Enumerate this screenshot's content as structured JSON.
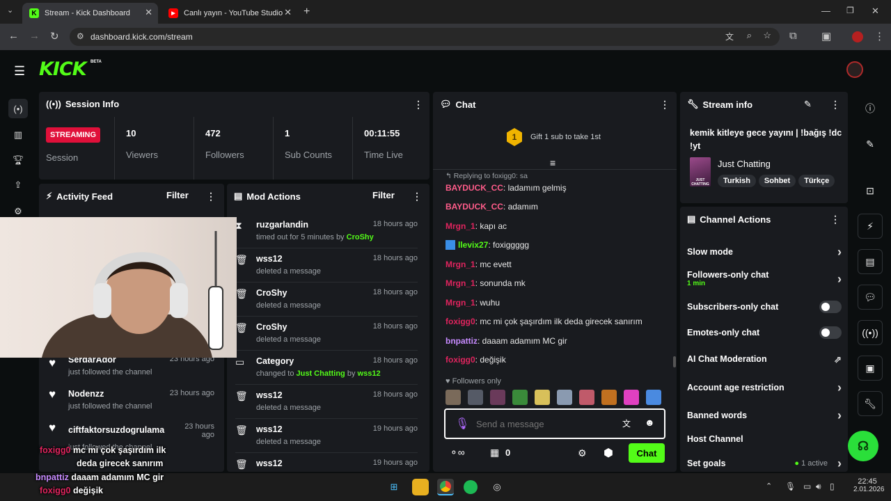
{
  "browser": {
    "tabs": [
      {
        "title": "Stream - Kick Dashboard",
        "active": true
      },
      {
        "title": "Canlı yayın - YouTube Studio",
        "active": false
      }
    ],
    "url": "dashboard.kick.com/stream"
  },
  "app": {
    "logo": "KICK",
    "logo_badge": "BETA",
    "accent": "#53fc18"
  },
  "session": {
    "title": "Session Info",
    "badge": "STREAMING",
    "session_label": "Session",
    "stats": [
      {
        "value": "10",
        "label": "Viewers"
      },
      {
        "value": "472",
        "label": "Followers"
      },
      {
        "value": "1",
        "label": "Sub Counts"
      },
      {
        "value": "00:11:55",
        "label": "Time Live"
      }
    ]
  },
  "activity": {
    "title": "Activity Feed",
    "filter": "Filter",
    "items": [
      {
        "name": "SerdarAdor",
        "time": "23 hours ago",
        "desc": "just followed the channel"
      },
      {
        "name": "Nodenzz",
        "time": "23 hours ago",
        "desc": "just followed the channel"
      },
      {
        "name": "ciftfaktorsuzdogrulama",
        "time": "23 hours ago",
        "desc": "just followed the channel"
      }
    ]
  },
  "mod": {
    "title": "Mod Actions",
    "filter": "Filter",
    "items": [
      {
        "icon": "hourglass-icon",
        "name": "ruzgarlandin",
        "time": "18 hours ago",
        "desc": "timed out for 5 minutes by",
        "target": "CroShy"
      },
      {
        "icon": "trash-icon",
        "name": "wss12",
        "time": "18 hours ago",
        "desc": "deleted a message"
      },
      {
        "icon": "trash-icon",
        "name": "CroShy",
        "time": "18 hours ago",
        "desc": "deleted a message"
      },
      {
        "icon": "trash-icon",
        "name": "CroShy",
        "time": "18 hours ago",
        "desc": "deleted a message"
      },
      {
        "icon": "category-icon",
        "name": "Category",
        "time": "18 hours ago",
        "desc": "changed to",
        "target": "Just Chatting",
        "by": "by",
        "byname": "wss12"
      },
      {
        "icon": "trash-icon",
        "name": "wss12",
        "time": "18 hours ago",
        "desc": "deleted a message"
      },
      {
        "icon": "trash-icon",
        "name": "wss12",
        "time": "19 hours ago",
        "desc": "deleted a message"
      },
      {
        "icon": "trash-icon",
        "name": "wss12",
        "time": "19 hours ago",
        "desc": ""
      }
    ]
  },
  "chat": {
    "title": "Chat",
    "gift_badge": "1",
    "gift_text": "Gift 1 sub to take 1st",
    "reply_text": "Replying to foxigg0: sa",
    "messages": [
      {
        "user": "BAYDUCK_CC",
        "color": "#ff5c8a",
        "text": ": ladamım gelmiş"
      },
      {
        "user": "BAYDUCK_CC",
        "color": "#ff5c8a",
        "text": ": adamım"
      },
      {
        "user": "Mrgn_1",
        "color": "#e0245e",
        "text": ": kapı ac"
      },
      {
        "user": "llevix27",
        "color": "#53fc18",
        "text": ": foxiggggg"
      },
      {
        "user": "Mrgn_1",
        "color": "#e0245e",
        "text": ": mc evett"
      },
      {
        "user": "Mrgn_1",
        "color": "#e0245e",
        "text": ": sonunda mk"
      },
      {
        "user": "Mrgn_1",
        "color": "#e0245e",
        "text": ": wuhu"
      },
      {
        "user": "foxigg0",
        "color": "#e0245e",
        "text": ": mc mi çok şaşırdım ilk deda girecek sanırım"
      },
      {
        "user": "bnpattiz",
        "color": "#c78bff",
        "text": ": daaam adamım MC gir"
      },
      {
        "user": "foxigg0",
        "color": "#e0245e",
        "text": ": değişik"
      }
    ],
    "followers_only": "Followers only",
    "placeholder": "Send a message",
    "count": "0",
    "send": "Chat"
  },
  "stream_info": {
    "title": "Stream info",
    "stream_title": "kemik kitleye gece yayını | !bağış !dc !yt",
    "category": "Just Chatting",
    "thumb_text": "JUST CHATTING",
    "tags": [
      "Turkish",
      "Sohbet",
      "Türkçe"
    ]
  },
  "channel_actions": {
    "title": "Channel Actions",
    "items": [
      {
        "label": "Slow mode",
        "type": "chevron"
      },
      {
        "label": "Followers-only chat",
        "sub": "1 min",
        "type": "chevron"
      },
      {
        "label": "Subscribers-only chat",
        "type": "toggle"
      },
      {
        "label": "Emotes-only chat",
        "type": "toggle"
      },
      {
        "label": "AI Chat Moderation",
        "type": "external"
      },
      {
        "label": "Account age restriction",
        "type": "chevron"
      },
      {
        "label": "Banned words",
        "type": "chevron"
      },
      {
        "label": "Host Channel",
        "type": "none"
      },
      {
        "label": "Set goals",
        "badge": "1 active",
        "type": "chevron"
      }
    ]
  },
  "overlay_chat": [
    {
      "user": "foxigg0",
      "color": "#e0245e",
      "text": "mc mi çok şaşırdım ilk"
    },
    {
      "user": "",
      "color": "#fff",
      "text": "deda girecek sanırım"
    },
    {
      "user": "bnpattiz",
      "color": "#c78bff",
      "text": "daaam adamım MC gir"
    },
    {
      "user": "foxigg0",
      "color": "#e0245e",
      "text": "değişik"
    }
  ],
  "taskbar": {
    "time": "22:45",
    "date": "2.01.2026"
  }
}
